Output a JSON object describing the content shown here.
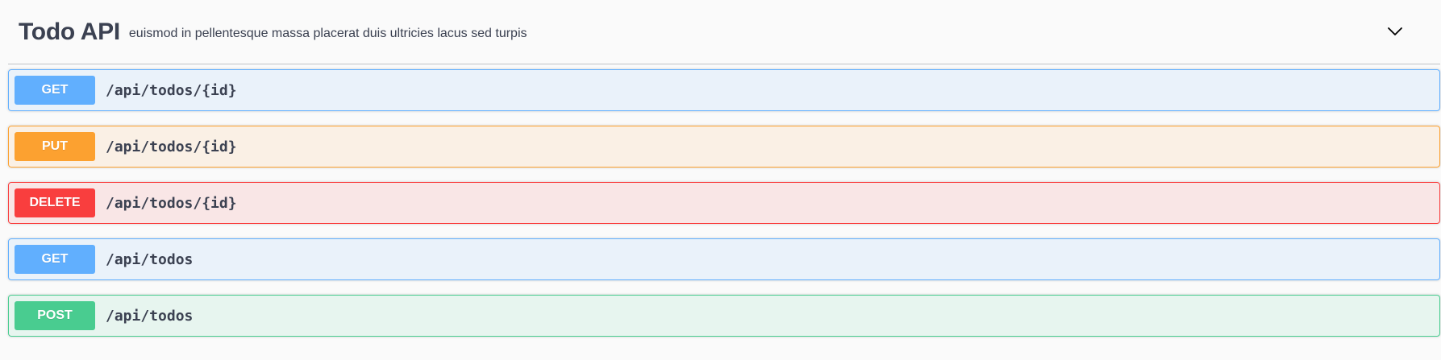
{
  "tag": {
    "title": "Todo API",
    "description": "euismod in pellentesque massa placerat duis ultricies lacus sed turpis",
    "expand_icon": "chevron-down-icon"
  },
  "operations": [
    {
      "method": "GET",
      "path": "/api/todos/{id}",
      "color": "#61affe"
    },
    {
      "method": "PUT",
      "path": "/api/todos/{id}",
      "color": "#fca130"
    },
    {
      "method": "DELETE",
      "path": "/api/todos/{id}",
      "color": "#f93e3e"
    },
    {
      "method": "GET",
      "path": "/api/todos",
      "color": "#61affe"
    },
    {
      "method": "POST",
      "path": "/api/todos",
      "color": "#49cc90"
    }
  ]
}
